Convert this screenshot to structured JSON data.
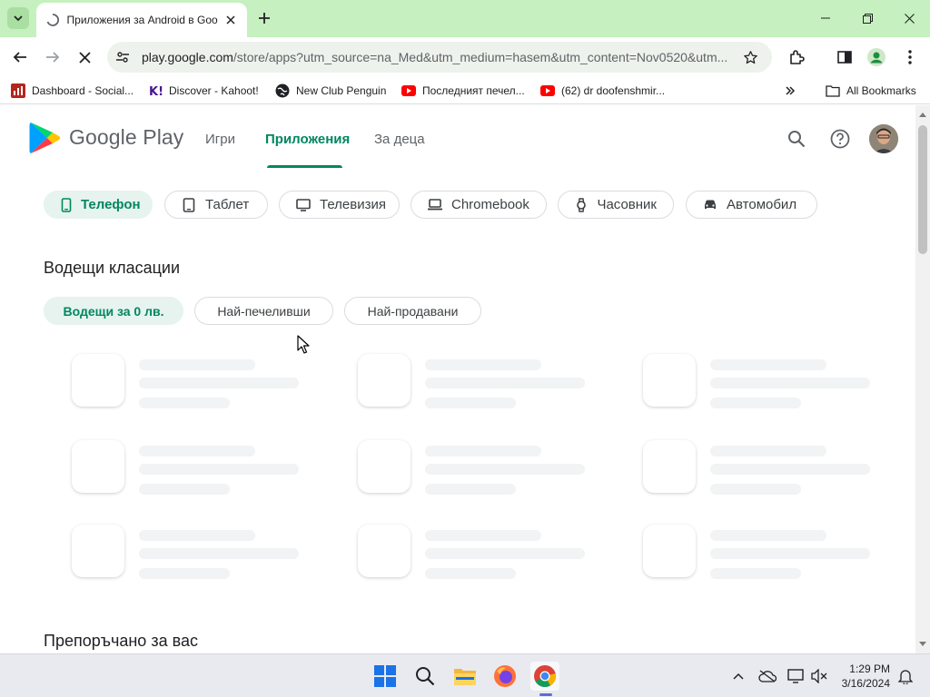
{
  "browser": {
    "tab_title": "Приложения за Android в Goo",
    "url_host": "play.google.com",
    "url_path": "/store/apps?utm_source=na_Med&utm_medium=hasem&utm_content=Nov0520&utm...",
    "bookmarks": [
      {
        "label": "Dashboard - Social...",
        "icon": "dashboard-icon"
      },
      {
        "label": "Discover - Kahoot!",
        "icon": "kahoot-icon"
      },
      {
        "label": "New Club Penguin",
        "icon": "globe-icon"
      },
      {
        "label": "Последният печел...",
        "icon": "youtube-icon"
      },
      {
        "label": "(62) dr doofenshmir...",
        "icon": "youtube-icon"
      }
    ],
    "all_bookmarks_label": "All Bookmarks"
  },
  "play": {
    "brand": "Google Play",
    "nav": [
      {
        "label": "Игри"
      },
      {
        "label": "Приложения"
      },
      {
        "label": "За деца"
      }
    ],
    "device_chips": [
      {
        "label": "Телефон",
        "icon": "phone-icon"
      },
      {
        "label": "Таблет",
        "icon": "tablet-icon"
      },
      {
        "label": "Телевизия",
        "icon": "tv-icon"
      },
      {
        "label": "Chromebook",
        "icon": "laptop-icon"
      },
      {
        "label": "Часовник",
        "icon": "watch-icon"
      },
      {
        "label": "Автомобил",
        "icon": "car-icon"
      }
    ],
    "top_charts_title": "Водещи класации",
    "chart_filters": [
      {
        "label": "Водещи за 0 лв."
      },
      {
        "label": "Най-печеливши"
      },
      {
        "label": "Най-продавани"
      }
    ],
    "recommended_title": "Препоръчано за вас"
  },
  "taskbar": {
    "time": "1:29 PM",
    "date": "3/16/2024"
  },
  "colors": {
    "titlebar": "#c6f0c0",
    "play_green": "#01875f",
    "selected_chip_bg": "#e6f3ef"
  }
}
